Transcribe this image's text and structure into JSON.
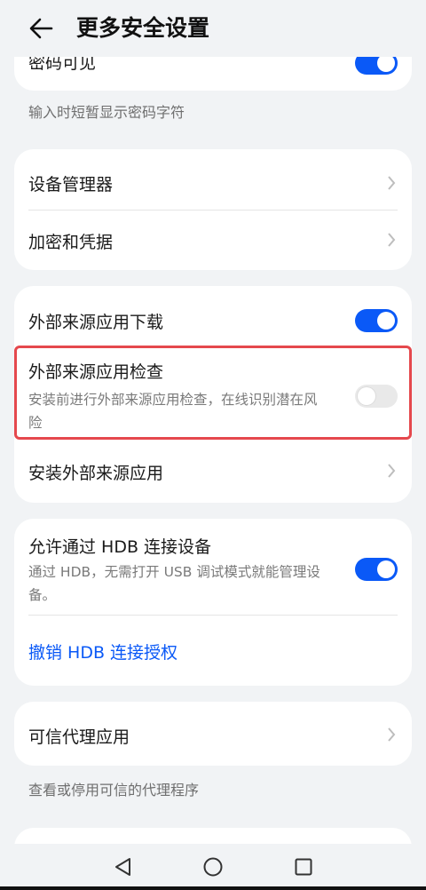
{
  "header": {
    "title": "更多安全设置",
    "back_icon": "arrow-left-icon"
  },
  "top_partial": {
    "label": "密码可见",
    "toggle_on": true,
    "hint": "输入时短暂显示密码字符"
  },
  "card_device": {
    "items": [
      {
        "label": "设备管理器",
        "icon": "chevron-right-icon"
      },
      {
        "label": "加密和凭据",
        "icon": "chevron-right-icon"
      }
    ]
  },
  "card_external": {
    "download": {
      "label": "外部来源应用下载",
      "toggle_on": true
    },
    "check": {
      "label": "外部来源应用检查",
      "description": "安装前进行外部来源应用检查，在线识别潜在风险",
      "toggle_on": false
    },
    "install": {
      "label": "安装外部来源应用",
      "icon": "chevron-right-icon"
    }
  },
  "card_hdb": {
    "label": "允许通过 HDB 连接设备",
    "description": "通过 HDB，无需打开 USB 调试模式就能管理设备。",
    "toggle_on": true,
    "revoke_link": "撤销 HDB 连接授权"
  },
  "card_trust": {
    "label": "可信代理应用",
    "icon": "chevron-right-icon",
    "hint": "查看或停用可信的代理程序"
  },
  "colors": {
    "accent": "#0a59f7",
    "highlight": "#e5484d",
    "background": "#f1f3f5"
  },
  "navbar": {
    "back": "triangle-back-icon",
    "home": "circle-home-icon",
    "recent": "square-recent-icon"
  }
}
